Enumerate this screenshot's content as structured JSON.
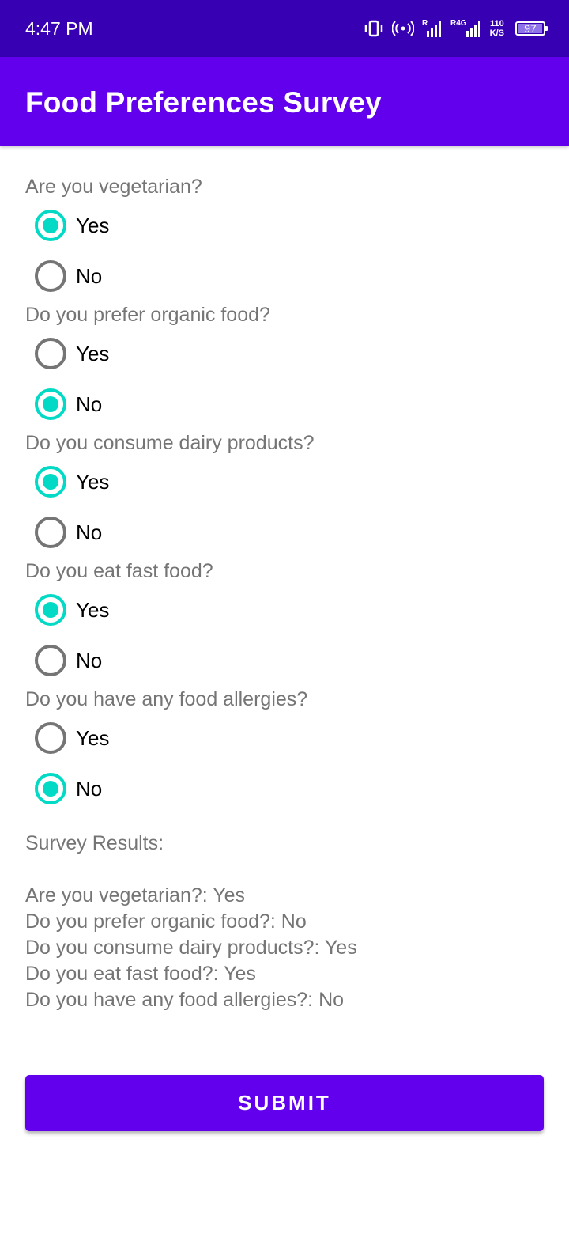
{
  "status_bar": {
    "time": "4:47 PM",
    "signal_1_label": "R",
    "signal_2_label": "R4G",
    "net_speed_value": "110",
    "net_speed_unit": "K/S",
    "battery_level": "97",
    "icons": [
      "vibrate-icon",
      "hotspot-icon",
      "signal-icon",
      "signal-icon",
      "battery-icon"
    ]
  },
  "app_bar": {
    "title": "Food Preferences Survey"
  },
  "questions": [
    {
      "text": "Are you vegetarian?",
      "yes_label": "Yes",
      "no_label": "No",
      "selected": "Yes"
    },
    {
      "text": "Do you prefer organic food?",
      "yes_label": "Yes",
      "no_label": "No",
      "selected": "No"
    },
    {
      "text": "Do you consume dairy products?",
      "yes_label": "Yes",
      "no_label": "No",
      "selected": "Yes"
    },
    {
      "text": "Do you eat fast food?",
      "yes_label": "Yes",
      "no_label": "No",
      "selected": "Yes"
    },
    {
      "text": "Do you have any food allergies?",
      "yes_label": "Yes",
      "no_label": "No",
      "selected": "No"
    }
  ],
  "results": {
    "heading": "Survey Results:",
    "lines": [
      "Are you vegetarian?: Yes",
      "Do you prefer organic food?: No",
      "Do you consume dairy products?: Yes",
      "Do you eat fast food?: Yes",
      "Do you have any food allergies?: No"
    ]
  },
  "submit_label": "SUBMIT",
  "colors": {
    "status_bar": "#3700b3",
    "app_bar": "#6200ee",
    "radio_checked": "#03dac5",
    "radio_unchecked": "#757575",
    "secondary_text": "#757575"
  }
}
